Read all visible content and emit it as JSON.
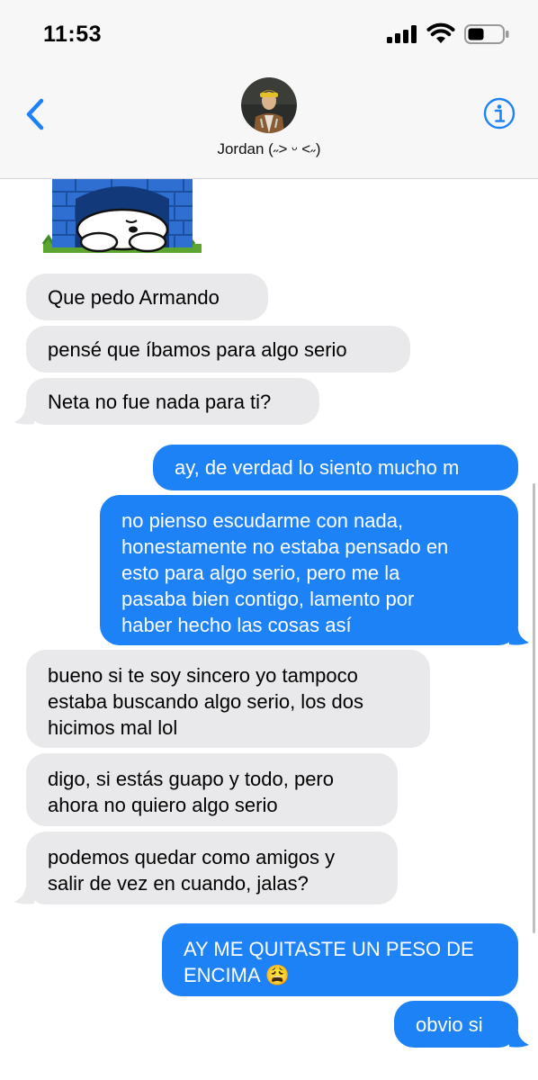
{
  "status_bar": {
    "time": "11:53"
  },
  "header": {
    "contact_name": "Jordan (˶˃ ᵕ ˂˶)"
  },
  "colors": {
    "sent_bubble": "#1e82f7",
    "received_bubble": "#e9e9eb",
    "accent": "#1e82f7"
  },
  "messages": [
    {
      "side": "received",
      "text": "Que pedo Armando"
    },
    {
      "side": "received",
      "text": "pensé que íbamos para algo serio"
    },
    {
      "side": "received",
      "text": "Neta no fue nada para ti?"
    },
    {
      "side": "sent",
      "text": "ay, de verdad lo siento mucho m"
    },
    {
      "side": "sent",
      "text": "no pienso escudarme con nada,\nhonestamente no estaba pensado en\nesto para algo serio, pero me la\npasaba bien contigo, lamento por\nhaber hecho las cosas así"
    },
    {
      "side": "received",
      "text": "bueno si te soy sincero yo tampoco\nestaba buscando algo serio, los dos\nhicimos mal lol"
    },
    {
      "side": "received",
      "text": "digo, si estás guapo y todo, pero\nahora no quiero algo serio"
    },
    {
      "side": "received",
      "text": "podemos quedar como amigos y\nsalir de vez en cuando, jalas?"
    },
    {
      "side": "sent",
      "text": "AY ME QUITASTE UN PESO DE\nENCIMA 😩"
    },
    {
      "side": "sent",
      "text": "obvio si"
    }
  ]
}
